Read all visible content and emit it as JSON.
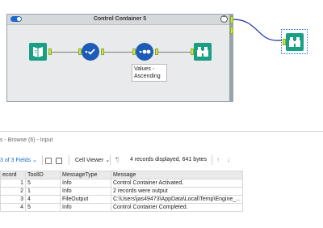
{
  "canvas": {
    "container_title": "Control Container 5",
    "collapse_symbol": "⌃",
    "tool_label": "Values - Ascending"
  },
  "panel": {
    "title_fragment": "s - Browse (6) - Input",
    "toolbar": {
      "fields_text": "3 of 3 Fields",
      "cell_viewer_label": "Cell Viewer",
      "records_info": "4 records displayed, 641 bytes"
    },
    "columns": [
      "ecord",
      "ToolID",
      "MessageType",
      "Message"
    ],
    "rows": [
      {
        "record": "1",
        "toolid": "5",
        "type": "Info",
        "message": "Control Container Activated."
      },
      {
        "record": "2",
        "toolid": "1",
        "type": "Info",
        "message": "2 records were output"
      },
      {
        "record": "3",
        "toolid": "4",
        "type": "FileOutput",
        "message": "C:\\Users\\jas49473\\AppData\\Local\\Temp\\Engine_..."
      },
      {
        "record": "4",
        "toolid": "5",
        "type": "Info",
        "message": "Control Container Completed."
      }
    ]
  },
  "colors": {
    "accent": "#1c69c9",
    "tool_teal": "#1a9e84",
    "tool_blue": "#1c5bb8",
    "anchor_green": "#c9e35c",
    "container_bg": "#e9eaeb"
  }
}
